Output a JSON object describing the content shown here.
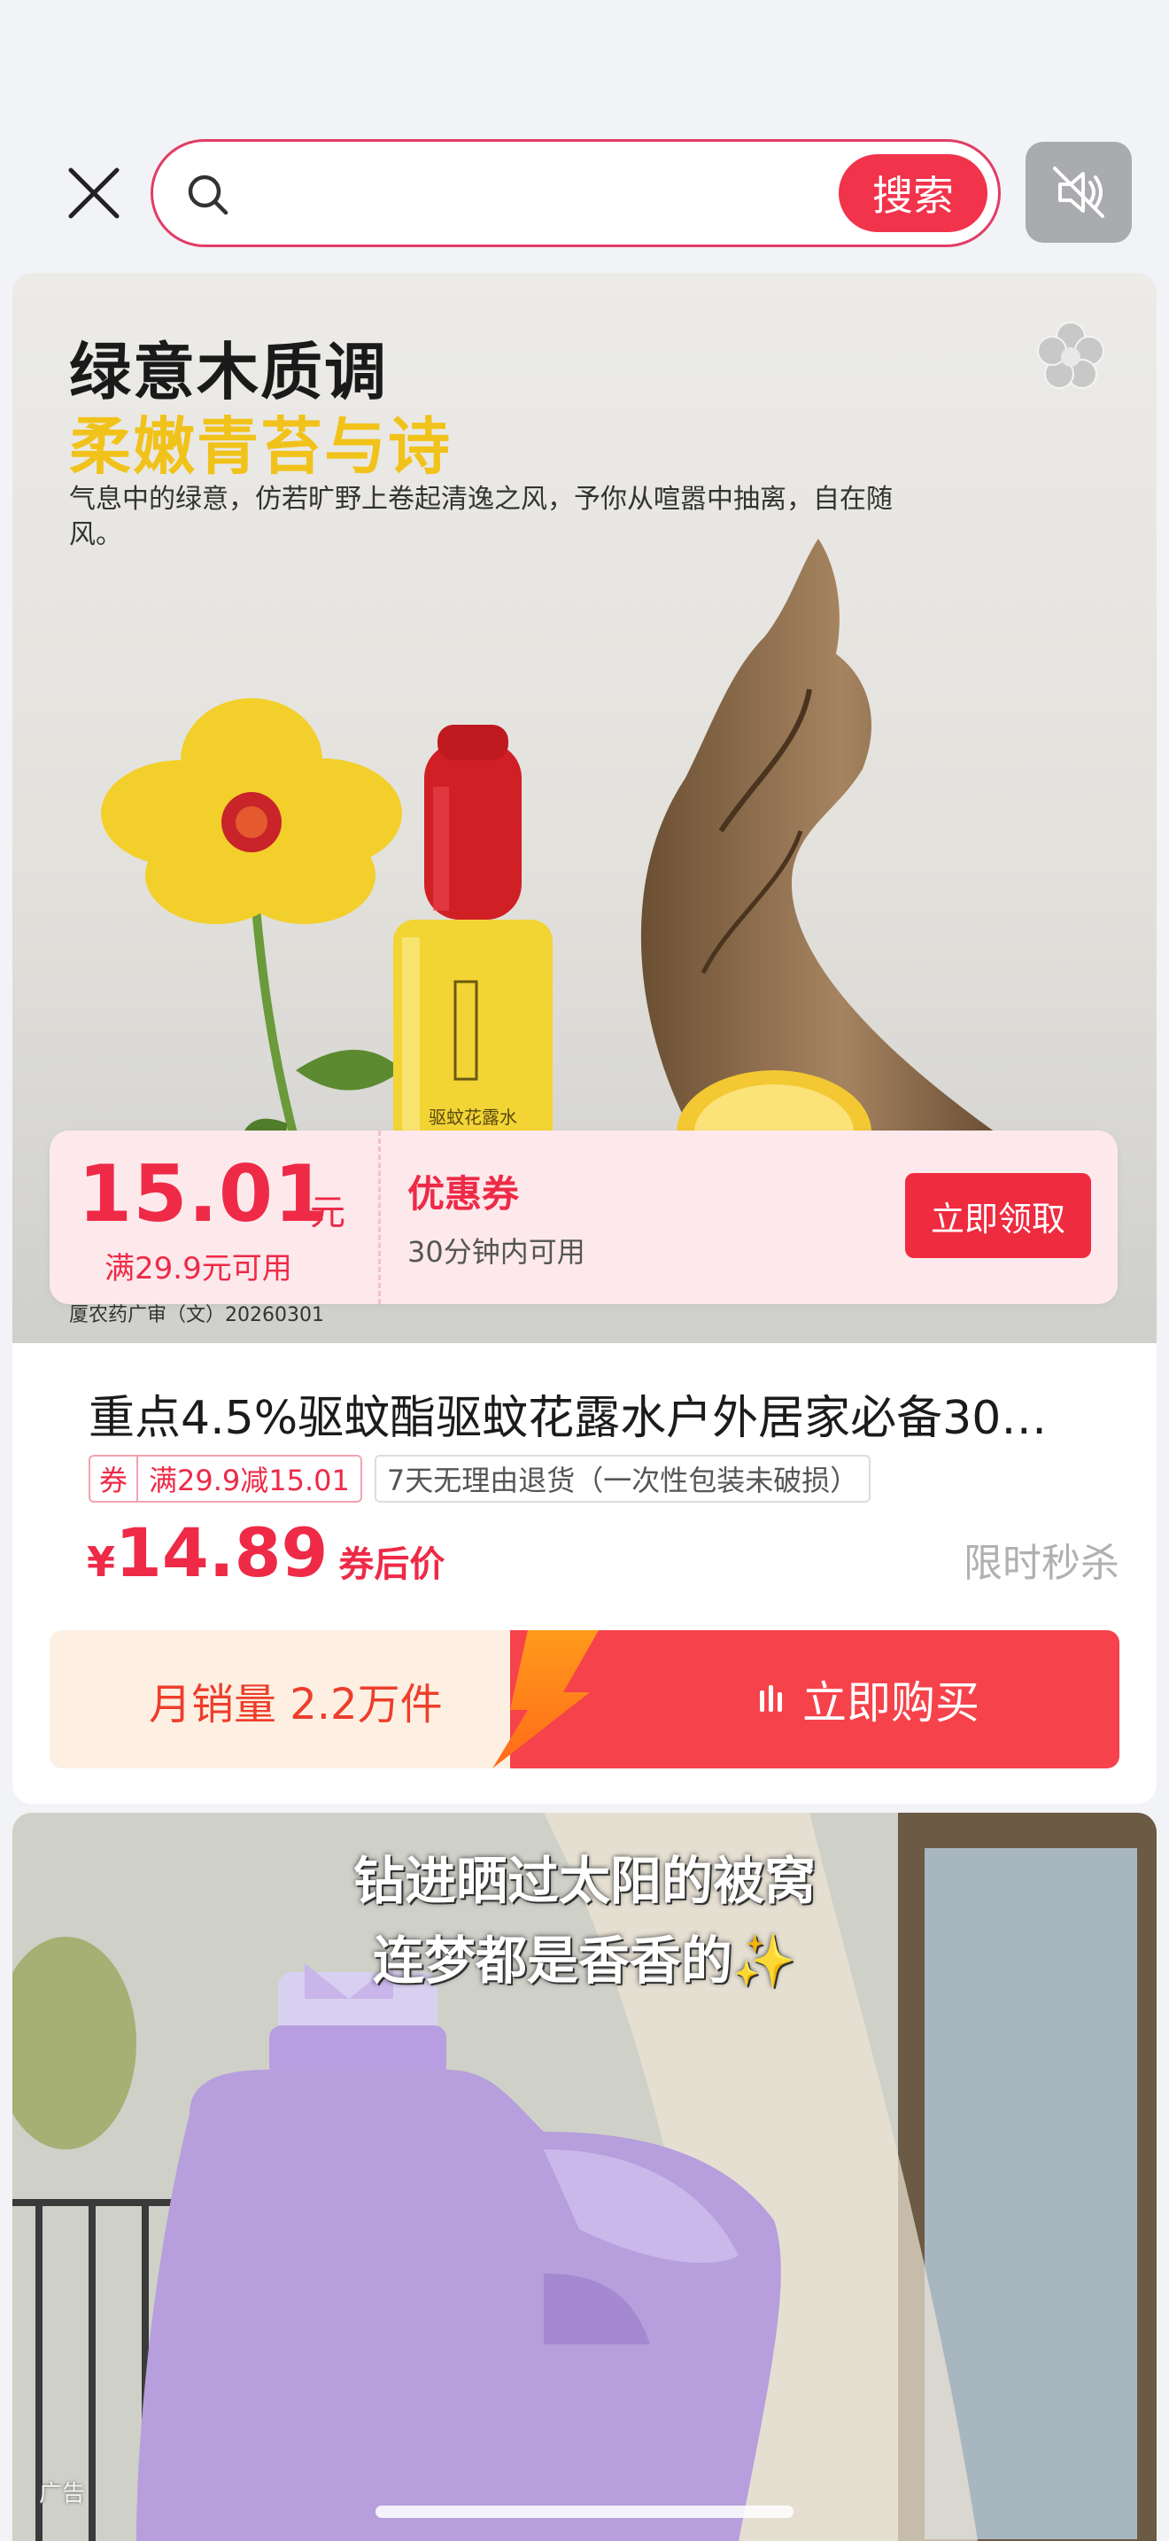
{
  "search": {
    "placeholder": "",
    "value": "",
    "button_label": "搜索"
  },
  "icons": {
    "close": "close-icon",
    "search": "search-icon",
    "mute": "speaker-muted-icon",
    "logo": "brand-flower-logo-icon",
    "buy": "bars-icon"
  },
  "ad1": {
    "title_line1": "绿意木质调",
    "title_line2": "柔嫩青苔与诗",
    "description": "气息中的绿意，仿若旷野上卷起清逸之风，予你从喧嚣中抽离，自在随风。",
    "bottle_label": "驱蚊花露水",
    "footnote": "厦农药广审（文）20260301",
    "coupon": {
      "amount": "15.01",
      "unit": "元",
      "condition": "满29.9元可用",
      "title": "优惠券",
      "subtitle": "30分钟内可用",
      "claim_button": "立即领取"
    },
    "product": {
      "title": "重点4.5%驱蚊酯驱蚊花露水户外居家必备30…",
      "tag_coupon_prefix": "券",
      "tag_coupon_value": "满29.9减15.01",
      "tag_return": "7天无理由退货（一次性包装未破损）",
      "price_currency": "¥",
      "price_value": "14.89",
      "price_suffix": "券后价",
      "flash_sale": "限时秒杀"
    },
    "buy_bar": {
      "sales": "月销量 2.2万件",
      "buy_button": "立即购买"
    }
  },
  "ad2": {
    "caption_line1": "钻进晒过太阳的被窝",
    "caption_line2": "连梦都是香香的✨",
    "ad_label": "广告"
  },
  "colors": {
    "accent": "#f2334c",
    "price_red": "#ee2a47",
    "coupon_bg": "#fde9ec",
    "sales_bg": "#fdf0e3",
    "yellow_title": "#f1c21a"
  }
}
